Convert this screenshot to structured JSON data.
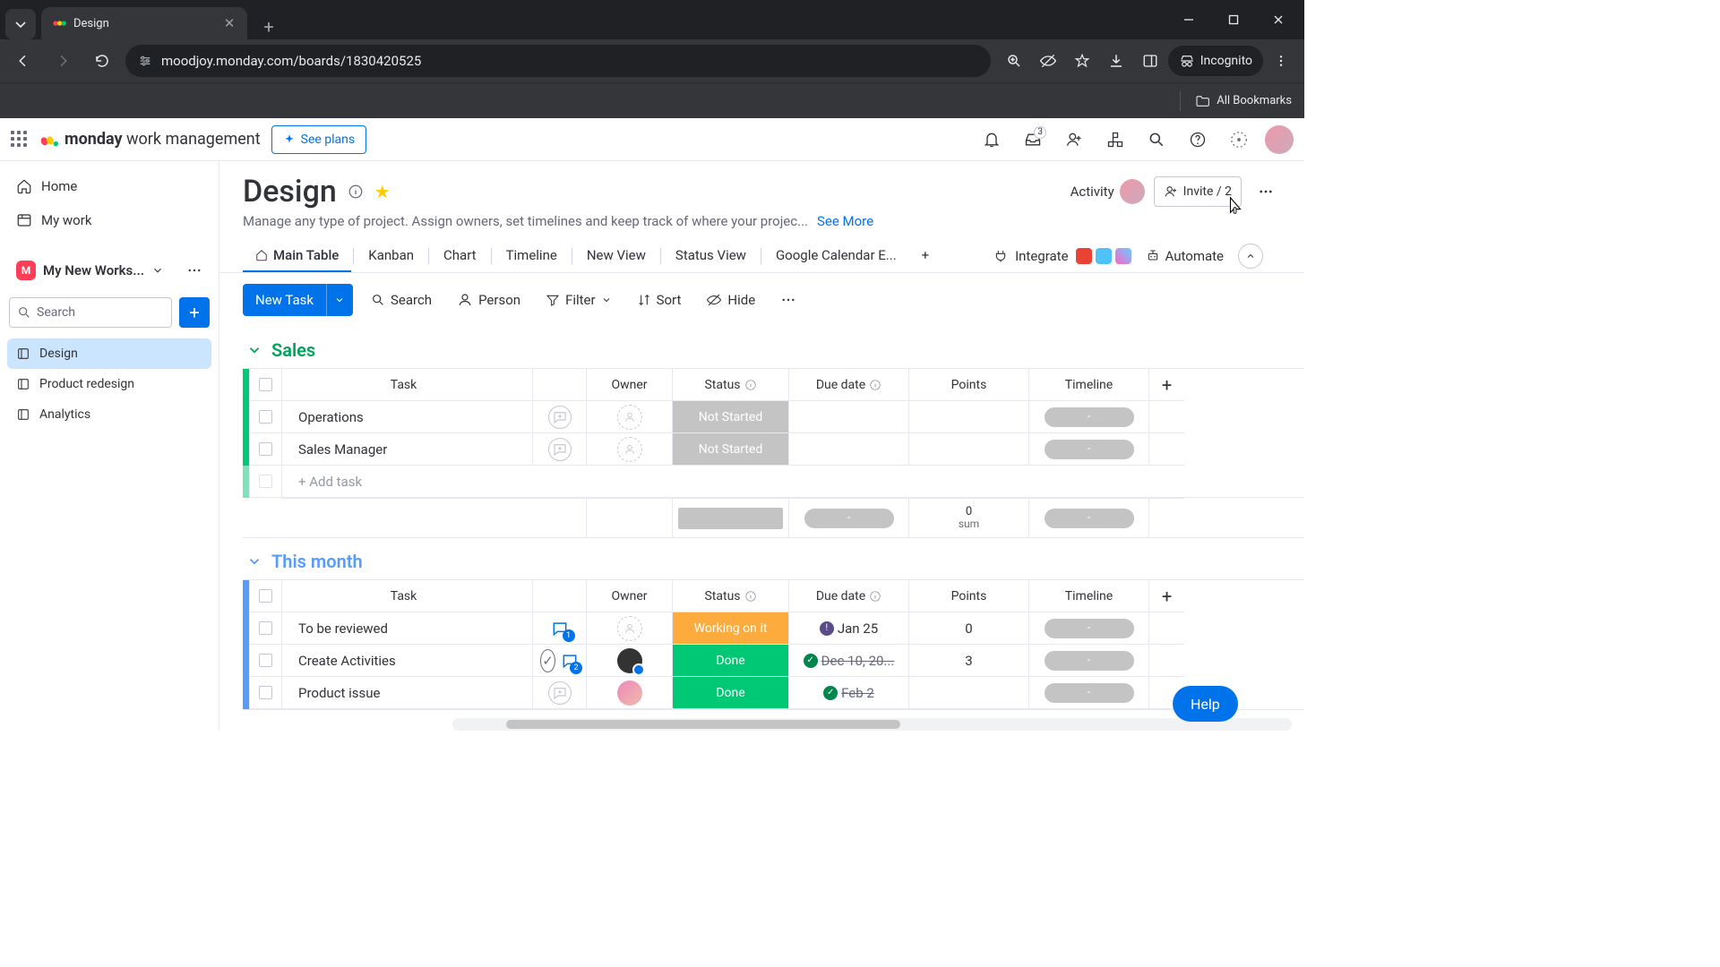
{
  "browser": {
    "tab_title": "Design",
    "url": "moodjoy.monday.com/boards/1830420525",
    "incognito_label": "Incognito",
    "all_bookmarks": "All Bookmarks"
  },
  "header": {
    "brand_bold": "monday",
    "brand_rest": " work management",
    "see_plans": "See plans",
    "inbox_badge": "3"
  },
  "sidebar": {
    "home": "Home",
    "mywork": "My work",
    "workspace": "My New Works...",
    "search_placeholder": "Search",
    "boards": [
      {
        "label": "Design"
      },
      {
        "label": "Product redesign"
      },
      {
        "label": "Analytics"
      }
    ]
  },
  "board": {
    "title": "Design",
    "desc": "Manage any type of project. Assign owners, set timelines and keep track of where your projec...",
    "see_more": "See More",
    "activity": "Activity",
    "invite": "Invite / 2",
    "views": [
      "Main Table",
      "Kanban",
      "Chart",
      "Timeline",
      "New View",
      "Status View",
      "Google Calendar E..."
    ],
    "integrate": "Integrate",
    "automate": "Automate"
  },
  "toolbar": {
    "new_task": "New Task",
    "search": "Search",
    "person": "Person",
    "filter": "Filter",
    "sort": "Sort",
    "hide": "Hide"
  },
  "columns": {
    "task": "Task",
    "owner": "Owner",
    "status": "Status",
    "due": "Due date",
    "points": "Points",
    "timeline": "Timeline"
  },
  "groups": [
    {
      "name": "Sales",
      "color": "green",
      "rows": [
        {
          "task": "Operations",
          "conv": "plus",
          "owner": "ph",
          "status": "Not Started",
          "status_cls": "st-notstarted",
          "due": "",
          "due_strike": false,
          "due_dot": "",
          "points": "",
          "tl": "-"
        },
        {
          "task": "Sales Manager",
          "conv": "plus",
          "owner": "ph",
          "status": "Not Started",
          "status_cls": "st-notstarted",
          "due": "",
          "due_strike": false,
          "due_dot": "",
          "points": "",
          "tl": "-"
        }
      ],
      "add_task": "+ Add task",
      "summary": {
        "points_value": "0",
        "points_label": "sum",
        "tl": "-",
        "due": "-"
      }
    },
    {
      "name": "This month",
      "color": "blue",
      "rows": [
        {
          "task": "To be reviewed",
          "conv": "chat",
          "conv_badge": "1",
          "owner": "ph",
          "status": "Working on it",
          "status_cls": "st-working",
          "due": "Jan 25",
          "due_strike": false,
          "due_dot": "purple",
          "points": "0",
          "tl": "-"
        },
        {
          "task": "Create Activities",
          "conv": "chat",
          "conv_badge": "2",
          "conv_done": true,
          "owner": "av",
          "status": "Done",
          "status_cls": "st-done",
          "due": "Dec 10, 20...",
          "due_strike": true,
          "due_dot": "green",
          "points": "3",
          "tl": "-"
        },
        {
          "task": "Product issue",
          "conv": "plus",
          "owner": "img",
          "status": "Done",
          "status_cls": "st-done",
          "due": "Feb 2",
          "due_strike": true,
          "due_dot": "green",
          "points": "",
          "tl": "-"
        }
      ]
    }
  ],
  "help": "Help"
}
